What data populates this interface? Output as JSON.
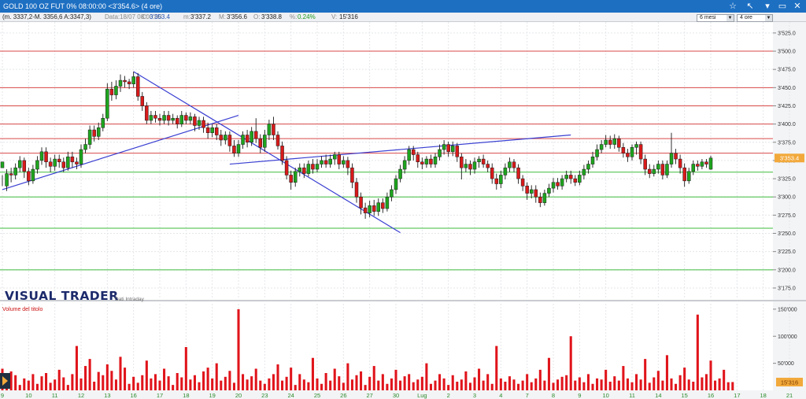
{
  "window": {
    "title": "GOLD 100 OZ FUT 0% 08:00:00  <3'354.6> (4 ore)",
    "buttons": [
      "☆",
      "↖",
      "▾",
      "▭",
      "✕"
    ]
  },
  "info_bar": {
    "formula": "(m. 3337,2-M. 3356,6 A:3347,3)",
    "date_label": "Data:",
    "date_value": "18/07 08:00:00",
    "close_label": "C:",
    "close_value": "3'353.4",
    "min_label": "m:",
    "min_value": "3'337.2",
    "max_label": "M:",
    "max_value": "3'356.6",
    "open_label": "O:",
    "open_value": "3'338.8",
    "pct_label": "%:",
    "pct_value": "0.24%",
    "volume_label": "V:",
    "volume_value": "15'316"
  },
  "controls": {
    "period": "6 mesi",
    "timeframe": "4 ore"
  },
  "branding": {
    "watermark": "VISUAL TRADER",
    "watermark_sub": "Dati Intraday"
  },
  "colors": {
    "up_candle": "#1ea51e",
    "down_candle": "#d81a1a",
    "resistance_lines": "#d94a4a",
    "support_lines": "#3dbb3d",
    "trendlines": "#3a3fd1",
    "volume_bars": "#e0141b",
    "last_price_tag": "#f2a93b",
    "last_volume_tag": "#f2a93b"
  },
  "chart_data": {
    "type": "candlestick",
    "y_axis": {
      "range": [
        3162,
        3540
      ],
      "ticks": [
        "3'525.0",
        "3'500.0",
        "3'475.0",
        "3'450.0",
        "3'425.0",
        "3'400.0",
        "3'375.0",
        "3'350.0",
        "3'325.0",
        "3'300.0",
        "3'275.0",
        "3'250.0",
        "3'225.0",
        "3'200.0",
        "3'175.0"
      ],
      "tick_values": [
        3525,
        3500,
        3475,
        3450,
        3425,
        3400,
        3375,
        3350,
        3325,
        3300,
        3275,
        3250,
        3225,
        3200,
        3175
      ]
    },
    "x_axis": {
      "labels": [
        "9",
        "10",
        "11",
        "12",
        "13",
        "16",
        "17",
        "18",
        "19",
        "20",
        "23",
        "24",
        "25",
        "26",
        "27",
        "30",
        "Lug",
        "2",
        "3",
        "4",
        "7",
        "8",
        "9",
        "10",
        "11",
        "14",
        "15",
        "16",
        "17",
        "18",
        "21"
      ],
      "label_bar_index": [
        0,
        6,
        12,
        18,
        24,
        30,
        36,
        42,
        48,
        54,
        60,
        66,
        72,
        78,
        84,
        90,
        96,
        102,
        108,
        114,
        120,
        126,
        132,
        138,
        144,
        150,
        156,
        162,
        168,
        174,
        180
      ]
    },
    "last_price": "3'353.4",
    "horizontal_levels": {
      "resistance": [
        3500,
        3450,
        3425,
        3400,
        3380,
        3360
      ],
      "support": [
        3334,
        3300,
        3257,
        3200
      ]
    },
    "trendlines": [
      {
        "from": [
          0,
          3310
        ],
        "to": [
          54,
          3412
        ]
      },
      {
        "from": [
          30,
          3472
        ],
        "to": [
          91,
          3251
        ]
      },
      {
        "from": [
          52,
          3345
        ],
        "to": [
          130,
          3385
        ]
      }
    ],
    "candles": [
      [
        3340,
        3348,
        3330,
        3315
      ],
      [
        3315,
        3332,
        3338,
        3308
      ],
      [
        3332,
        3330,
        3340,
        3320
      ],
      [
        3330,
        3340,
        3346,
        3324
      ],
      [
        3340,
        3350,
        3356,
        3334
      ],
      [
        3350,
        3335,
        3354,
        3326
      ],
      [
        3335,
        3322,
        3340,
        3316
      ],
      [
        3322,
        3338,
        3344,
        3318
      ],
      [
        3338,
        3350,
        3356,
        3332
      ],
      [
        3350,
        3362,
        3368,
        3344
      ],
      [
        3362,
        3348,
        3368,
        3340
      ],
      [
        3348,
        3342,
        3354,
        3334
      ],
      [
        3342,
        3352,
        3358,
        3336
      ],
      [
        3352,
        3348,
        3358,
        3340
      ],
      [
        3348,
        3340,
        3354,
        3334
      ],
      [
        3340,
        3355,
        3362,
        3336
      ],
      [
        3355,
        3348,
        3362,
        3340
      ],
      [
        3348,
        3345,
        3354,
        3338
      ],
      [
        3345,
        3365,
        3372,
        3340
      ],
      [
        3365,
        3372,
        3380,
        3360
      ],
      [
        3372,
        3392,
        3398,
        3366
      ],
      [
        3392,
        3383,
        3398,
        3376
      ],
      [
        3383,
        3395,
        3402,
        3378
      ],
      [
        3395,
        3408,
        3414,
        3390
      ],
      [
        3408,
        3448,
        3456,
        3404
      ],
      [
        3448,
        3440,
        3458,
        3432
      ],
      [
        3440,
        3452,
        3460,
        3434
      ],
      [
        3452,
        3460,
        3468,
        3444
      ],
      [
        3460,
        3458,
        3466,
        3450
      ],
      [
        3458,
        3455,
        3462,
        3448
      ],
      [
        3455,
        3465,
        3472,
        3450
      ],
      [
        3465,
        3438,
        3470,
        3432
      ],
      [
        3438,
        3425,
        3444,
        3418
      ],
      [
        3425,
        3405,
        3430,
        3400
      ],
      [
        3405,
        3412,
        3418,
        3400
      ],
      [
        3412,
        3408,
        3418,
        3402
      ],
      [
        3408,
        3405,
        3414,
        3398
      ],
      [
        3405,
        3412,
        3418,
        3400
      ],
      [
        3412,
        3405,
        3418,
        3398
      ],
      [
        3405,
        3408,
        3414,
        3400
      ],
      [
        3408,
        3400,
        3412,
        3394
      ],
      [
        3400,
        3412,
        3418,
        3396
      ],
      [
        3412,
        3405,
        3416,
        3400
      ],
      [
        3405,
        3410,
        3416,
        3400
      ],
      [
        3410,
        3398,
        3414,
        3390
      ],
      [
        3398,
        3405,
        3410,
        3392
      ],
      [
        3405,
        3395,
        3410,
        3388
      ],
      [
        3395,
        3388,
        3402,
        3380
      ],
      [
        3388,
        3395,
        3400,
        3382
      ],
      [
        3395,
        3385,
        3400,
        3378
      ],
      [
        3385,
        3378,
        3392,
        3370
      ],
      [
        3378,
        3385,
        3390,
        3372
      ],
      [
        3385,
        3370,
        3390,
        3362
      ],
      [
        3370,
        3360,
        3378,
        3355
      ],
      [
        3360,
        3372,
        3378,
        3355
      ],
      [
        3372,
        3385,
        3390,
        3366
      ],
      [
        3385,
        3375,
        3392,
        3368
      ],
      [
        3375,
        3390,
        3396,
        3370
      ],
      [
        3390,
        3380,
        3408,
        3374
      ],
      [
        3380,
        3368,
        3386,
        3360
      ],
      [
        3368,
        3385,
        3392,
        3362
      ],
      [
        3385,
        3400,
        3406,
        3378
      ],
      [
        3400,
        3385,
        3410,
        3378
      ],
      [
        3385,
        3370,
        3390,
        3365
      ],
      [
        3370,
        3350,
        3376,
        3344
      ],
      [
        3350,
        3330,
        3356,
        3324
      ],
      [
        3330,
        3320,
        3336,
        3310
      ],
      [
        3320,
        3335,
        3340,
        3314
      ],
      [
        3335,
        3340,
        3346,
        3328
      ],
      [
        3340,
        3332,
        3346,
        3326
      ],
      [
        3332,
        3345,
        3350,
        3328
      ],
      [
        3345,
        3338,
        3352,
        3332
      ],
      [
        3338,
        3345,
        3352,
        3334
      ],
      [
        3345,
        3350,
        3356,
        3340
      ],
      [
        3350,
        3345,
        3358,
        3340
      ],
      [
        3345,
        3352,
        3358,
        3340
      ],
      [
        3352,
        3358,
        3362,
        3344
      ],
      [
        3358,
        3345,
        3362,
        3338
      ],
      [
        3345,
        3350,
        3356,
        3340
      ],
      [
        3350,
        3340,
        3355,
        3330
      ],
      [
        3340,
        3320,
        3346,
        3312
      ],
      [
        3320,
        3300,
        3326,
        3292
      ],
      [
        3300,
        3285,
        3306,
        3276
      ],
      [
        3285,
        3278,
        3292,
        3270
      ],
      [
        3278,
        3288,
        3295,
        3272
      ],
      [
        3288,
        3280,
        3296,
        3274
      ],
      [
        3280,
        3292,
        3298,
        3274
      ],
      [
        3292,
        3284,
        3298,
        3278
      ],
      [
        3284,
        3300,
        3306,
        3280
      ],
      [
        3300,
        3310,
        3316,
        3294
      ],
      [
        3310,
        3325,
        3330,
        3304
      ],
      [
        3325,
        3338,
        3344,
        3320
      ],
      [
        3338,
        3350,
        3356,
        3332
      ],
      [
        3350,
        3365,
        3370,
        3344
      ],
      [
        3365,
        3358,
        3370,
        3350
      ],
      [
        3358,
        3348,
        3362,
        3340
      ],
      [
        3348,
        3345,
        3354,
        3338
      ],
      [
        3345,
        3352,
        3356,
        3340
      ],
      [
        3352,
        3345,
        3358,
        3340
      ],
      [
        3345,
        3355,
        3360,
        3340
      ],
      [
        3355,
        3365,
        3372,
        3350
      ],
      [
        3365,
        3372,
        3378,
        3358
      ],
      [
        3372,
        3362,
        3376,
        3355
      ],
      [
        3362,
        3370,
        3376,
        3356
      ],
      [
        3370,
        3355,
        3374,
        3348
      ],
      [
        3355,
        3340,
        3360,
        3324
      ],
      [
        3340,
        3345,
        3352,
        3334
      ],
      [
        3345,
        3338,
        3350,
        3330
      ],
      [
        3338,
        3348,
        3354,
        3332
      ],
      [
        3348,
        3352,
        3356,
        3340
      ],
      [
        3352,
        3345,
        3358,
        3340
      ],
      [
        3345,
        3340,
        3350,
        3334
      ],
      [
        3340,
        3325,
        3346,
        3318
      ],
      [
        3325,
        3318,
        3332,
        3310
      ],
      [
        3318,
        3330,
        3336,
        3312
      ],
      [
        3330,
        3340,
        3346,
        3324
      ],
      [
        3340,
        3348,
        3354,
        3334
      ],
      [
        3348,
        3340,
        3352,
        3334
      ],
      [
        3340,
        3325,
        3345,
        3318
      ],
      [
        3325,
        3315,
        3330,
        3308
      ],
      [
        3315,
        3305,
        3320,
        3296
      ],
      [
        3305,
        3310,
        3316,
        3298
      ],
      [
        3310,
        3300,
        3316,
        3292
      ],
      [
        3300,
        3292,
        3306,
        3286
      ],
      [
        3292,
        3305,
        3310,
        3288
      ],
      [
        3305,
        3312,
        3318,
        3300
      ],
      [
        3312,
        3320,
        3326,
        3306
      ],
      [
        3320,
        3315,
        3326,
        3310
      ],
      [
        3315,
        3325,
        3330,
        3310
      ],
      [
        3325,
        3330,
        3336,
        3320
      ],
      [
        3330,
        3325,
        3336,
        3318
      ],
      [
        3325,
        3320,
        3330,
        3315
      ],
      [
        3320,
        3330,
        3336,
        3316
      ],
      [
        3330,
        3338,
        3344,
        3324
      ],
      [
        3338,
        3345,
        3350,
        3332
      ],
      [
        3345,
        3355,
        3362,
        3340
      ],
      [
        3355,
        3365,
        3372,
        3350
      ],
      [
        3365,
        3372,
        3378,
        3360
      ],
      [
        3372,
        3378,
        3385,
        3368
      ],
      [
        3378,
        3372,
        3384,
        3366
      ],
      [
        3372,
        3380,
        3386,
        3366
      ],
      [
        3380,
        3368,
        3384,
        3362
      ],
      [
        3368,
        3360,
        3374,
        3354
      ],
      [
        3360,
        3355,
        3366,
        3348
      ],
      [
        3355,
        3368,
        3372,
        3350
      ],
      [
        3368,
        3372,
        3376,
        3358
      ],
      [
        3372,
        3352,
        3376,
        3345
      ],
      [
        3352,
        3338,
        3358,
        3330
      ],
      [
        3338,
        3332,
        3345,
        3326
      ],
      [
        3332,
        3338,
        3344,
        3328
      ],
      [
        3338,
        3345,
        3350,
        3332
      ],
      [
        3345,
        3330,
        3350,
        3324
      ],
      [
        3330,
        3345,
        3350,
        3326
      ],
      [
        3345,
        3360,
        3388,
        3340
      ],
      [
        3360,
        3352,
        3366,
        3345
      ],
      [
        3352,
        3340,
        3358,
        3332
      ],
      [
        3340,
        3322,
        3346,
        3314
      ],
      [
        3322,
        3335,
        3340,
        3318
      ],
      [
        3335,
        3345,
        3350,
        3330
      ],
      [
        3345,
        3342,
        3350,
        3336
      ],
      [
        3342,
        3348,
        3352,
        3338
      ],
      [
        3348,
        3345,
        3352,
        3340
      ],
      [
        3338,
        3353.4,
        3356.6,
        3337.2
      ]
    ],
    "volume": {
      "title": "Volume del titolo",
      "range": [
        0,
        160000
      ],
      "ticks": [
        "150'000",
        "100'000",
        "50'000"
      ],
      "tick_values": [
        150000,
        100000,
        50000
      ],
      "last_value": "15'316",
      "values": [
        40000,
        15000,
        35000,
        28000,
        10000,
        22000,
        18000,
        30000,
        12000,
        26000,
        32000,
        14000,
        20000,
        38000,
        24000,
        10000,
        30000,
        82000,
        22000,
        45000,
        58000,
        16000,
        34000,
        28000,
        48000,
        36000,
        20000,
        62000,
        42000,
        12000,
        25000,
        14000,
        28000,
        55000,
        22000,
        30000,
        18000,
        40000,
        26000,
        10000,
        32000,
        24000,
        80000,
        20000,
        28000,
        15000,
        35000,
        42000,
        22000,
        50000,
        18000,
        25000,
        36000,
        14000,
        150000,
        30000,
        20000,
        26000,
        40000,
        18000,
        12000,
        22000,
        30000,
        48000,
        18000,
        25000,
        42000,
        10000,
        30000,
        20000,
        15000,
        60000,
        22000,
        12000,
        32000,
        18000,
        40000,
        26000,
        14000,
        50000,
        20000,
        28000,
        35000,
        10000,
        25000,
        45000,
        18000,
        30000,
        12000,
        22000,
        38000,
        18000,
        26000,
        30000,
        15000,
        20000,
        25000,
        50000,
        12000,
        18000,
        30000,
        22000,
        10000,
        28000,
        16000,
        20000,
        35000,
        14000,
        24000,
        40000,
        18000,
        30000,
        12000,
        82000,
        22000,
        16000,
        26000,
        20000,
        12000,
        18000,
        30000,
        15000,
        22000,
        38000,
        18000,
        60000,
        14000,
        20000,
        25000,
        28000,
        100000,
        18000,
        24000,
        15000,
        30000,
        12000,
        22000,
        20000,
        38000,
        16000,
        26000,
        18000,
        45000,
        22000,
        15000,
        30000,
        20000,
        58000,
        14000,
        24000,
        36000,
        18000,
        65000,
        22000,
        12000,
        28000,
        42000,
        20000,
        16000,
        140000,
        24000,
        30000,
        55000,
        18000,
        22000,
        38000,
        15000,
        15316
      ]
    }
  }
}
